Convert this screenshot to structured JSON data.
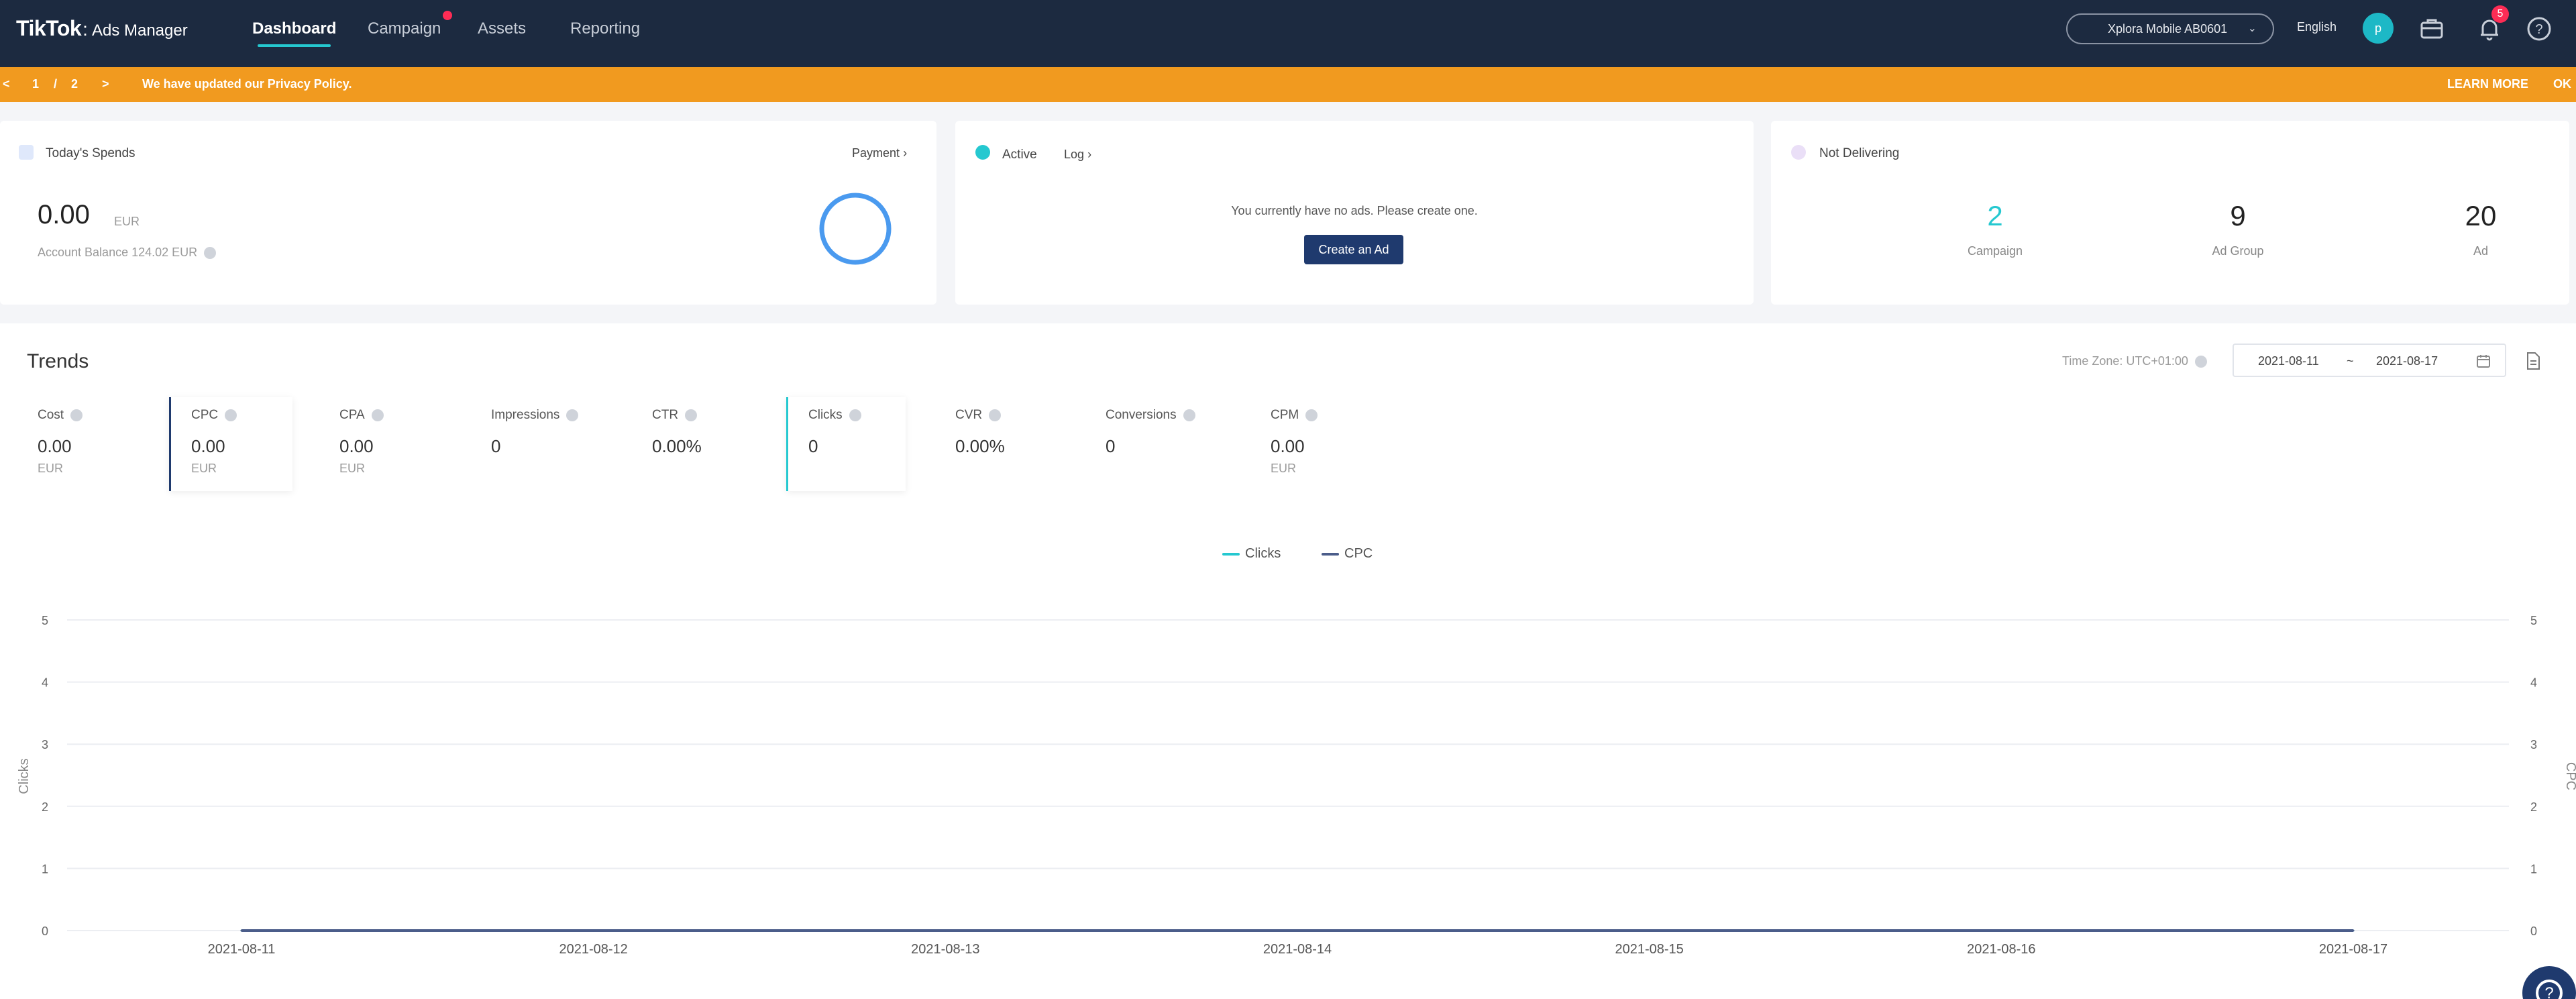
{
  "nav": {
    "brand_main": "TikTok",
    "brand_sep": ":",
    "brand_sub": "Ads Manager",
    "items": [
      {
        "label": "Dashboard",
        "active": true
      },
      {
        "label": "Campaign",
        "active": false
      },
      {
        "label": "Assets",
        "active": false
      },
      {
        "label": "Reporting",
        "active": false
      }
    ],
    "account_selector": "Xplora Mobile AB0601",
    "language": "English",
    "avatar_initial": "p",
    "notification_count": "5"
  },
  "notice": {
    "page_prev": "<",
    "page_current": "1",
    "page_sep": "/",
    "page_total": "2",
    "page_next": ">",
    "message": "We have updated our Privacy Policy.",
    "learn_more": "LEARN MORE",
    "ok": "OK"
  },
  "spends_card": {
    "title": "Today's Spends",
    "payment_link": "Payment",
    "amount": "0.00",
    "currency": "EUR",
    "balance_text": "Account Balance 124.02 EUR"
  },
  "active_card": {
    "title": "Active",
    "log_link": "Log",
    "empty_message": "You currently have no ads. Please create one.",
    "create_button": "Create an Ad"
  },
  "not_delivering_card": {
    "title": "Not Delivering",
    "stats": [
      {
        "value": "2",
        "label": "Campaign"
      },
      {
        "value": "9",
        "label": "Ad Group"
      },
      {
        "value": "20",
        "label": "Ad"
      }
    ]
  },
  "trends": {
    "title": "Trends",
    "timezone": "Time Zone: UTC+01:00",
    "date_start": "2021-08-11",
    "date_sep": "~",
    "date_end": "2021-08-17",
    "metrics": [
      {
        "label": "Cost",
        "value": "0.00",
        "unit": "EUR"
      },
      {
        "label": "CPC",
        "value": "0.00",
        "unit": "EUR"
      },
      {
        "label": "CPA",
        "value": "0.00",
        "unit": "EUR"
      },
      {
        "label": "Impressions",
        "value": "0",
        "unit": ""
      },
      {
        "label": "CTR",
        "value": "0.00%",
        "unit": ""
      },
      {
        "label": "Clicks",
        "value": "0",
        "unit": ""
      },
      {
        "label": "CVR",
        "value": "0.00%",
        "unit": ""
      },
      {
        "label": "Conversions",
        "value": "0",
        "unit": ""
      },
      {
        "label": "CPM",
        "value": "0.00",
        "unit": "EUR"
      }
    ]
  },
  "colors": {
    "nav_bg": "#1c2a40",
    "notice_bg": "#f19a1f",
    "accent_teal": "#25c8d0",
    "primary_navy": "#1f3a6e",
    "badge_red": "#fe2c55"
  },
  "chart_data": {
    "type": "line",
    "x": [
      "2021-08-11",
      "2021-08-12",
      "2021-08-13",
      "2021-08-14",
      "2021-08-15",
      "2021-08-16",
      "2021-08-17"
    ],
    "series": [
      {
        "name": "Clicks",
        "values": [
          0,
          0,
          0,
          0,
          0,
          0,
          0
        ],
        "color": "#25c8d0",
        "axis": "left"
      },
      {
        "name": "CPC",
        "values": [
          0,
          0,
          0,
          0,
          0,
          0,
          0
        ],
        "color": "#4b5d8a",
        "axis": "right"
      }
    ],
    "ylabel": "Clicks",
    "y2label": "CPC",
    "ylim": [
      0,
      5
    ],
    "y2lim": [
      0,
      5
    ],
    "yticks": [
      "0",
      "1",
      "2",
      "3",
      "4",
      "5"
    ],
    "y2ticks": [
      "0",
      "1",
      "2",
      "3",
      "4",
      "5"
    ],
    "grid": true,
    "legend": "top-center"
  }
}
